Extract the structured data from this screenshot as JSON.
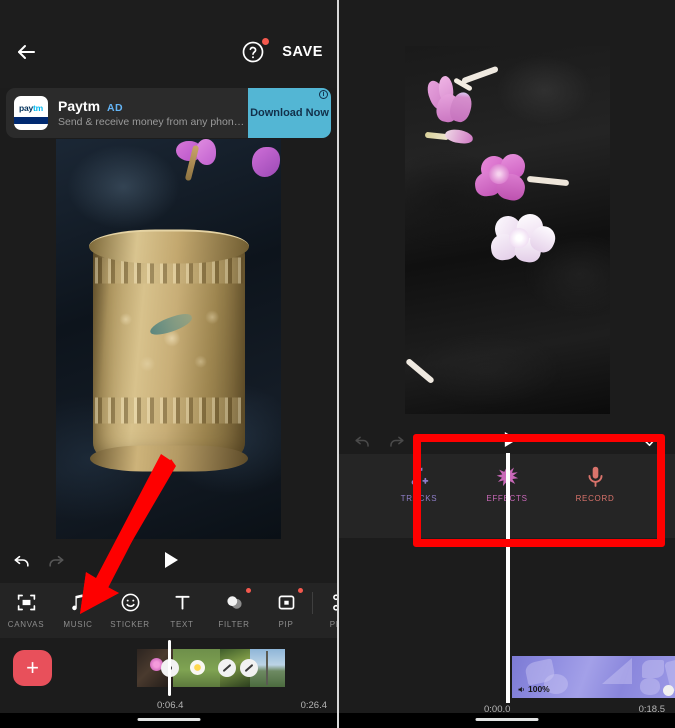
{
  "app": {
    "accent_red": "#fe0000",
    "add_button_color": "#e8505b",
    "background": "#1c1c1c"
  },
  "left_panel": {
    "header": {
      "back_icon": "back-arrow-icon",
      "help_icon": "help-question-icon",
      "help_badge": true,
      "save_label": "SAVE"
    },
    "ad": {
      "brand": "Paytm",
      "logo_text_a": "pay",
      "logo_text_b": "tm",
      "badge": "AD",
      "description": "Send & receive money from any phone ...",
      "cta_label": "Download Now",
      "info_glyph": "i",
      "cta_color": "#53b6d4"
    },
    "controls": {
      "undo_icon": "undo-icon",
      "redo_icon": "redo-icon",
      "play_icon": "play-icon"
    },
    "toolbar": [
      {
        "label": "CANVAS",
        "icon": "canvas-frame-icon",
        "badge": false
      },
      {
        "label": "MUSIC",
        "icon": "music-note-icon",
        "badge": false
      },
      {
        "label": "STICKER",
        "icon": "smiley-sticker-icon",
        "badge": false
      },
      {
        "label": "TEXT",
        "icon": "text-t-icon",
        "badge": false
      },
      {
        "label": "FILTER",
        "icon": "filter-circles-icon",
        "badge": true
      },
      {
        "label": "PIP",
        "icon": "pip-square-icon",
        "badge": true
      },
      {
        "label": "PRE",
        "icon": "precut-scissors-icon",
        "badge": false
      }
    ],
    "timeline": {
      "add_label": "+",
      "current_time": "0:06.4",
      "total_time": "0:26.4",
      "clip_count": 4,
      "transition_markers": 3
    }
  },
  "right_panel": {
    "controls": {
      "undo_icon": "undo-icon",
      "redo_icon": "redo-icon",
      "play_icon": "play-icon",
      "confirm_icon": "checkmark-icon"
    },
    "audio_tools": [
      {
        "label": "TRACKS",
        "icon": "music-note-plus-icon",
        "color": "#8f7ec8"
      },
      {
        "label": "EFFECTS",
        "icon": "starburst-sparkle-icon",
        "color": "#c968b8"
      },
      {
        "label": "RECORD",
        "icon": "microphone-icon",
        "color": "#d9736b"
      }
    ],
    "timeline": {
      "current_time": "0:00.0",
      "total_time": "0:18.5",
      "volume_label": "100%",
      "volume_icon": "speaker-icon"
    },
    "highlight": {
      "shape": "rectangle",
      "color": "#fe0000",
      "target": "audio-tools-row"
    }
  },
  "annotation": {
    "arrow_color": "#fe0000",
    "points_to": "music-toolbar-button"
  }
}
